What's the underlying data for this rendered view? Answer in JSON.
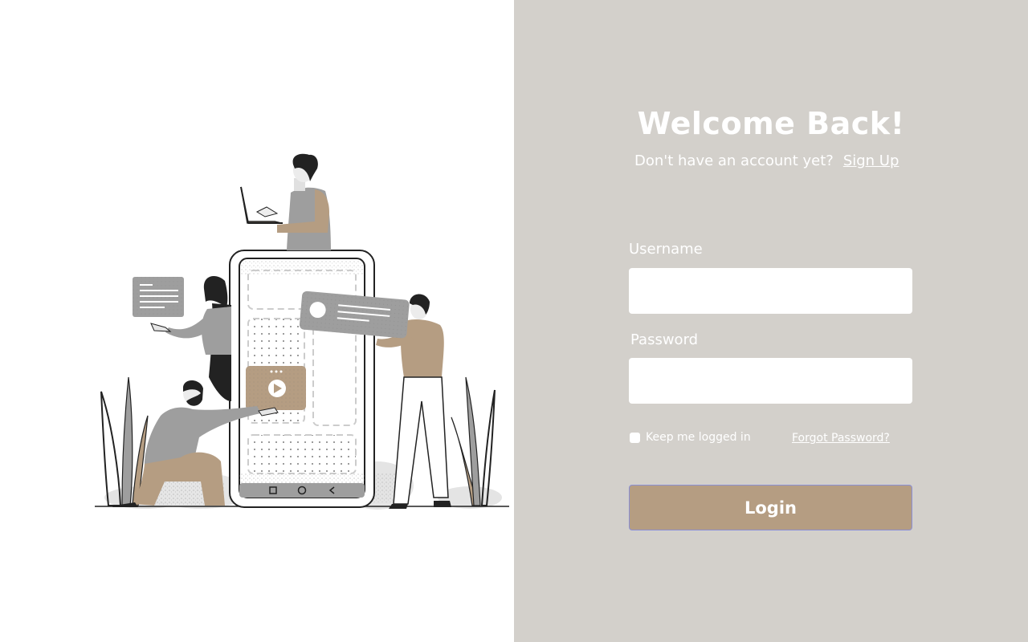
{
  "login": {
    "title": "Welcome Back!",
    "subtitle_text": "Don't have an account yet?",
    "signup_link": "Sign Up",
    "username_label": "Username",
    "username_value": "",
    "password_label": "Password",
    "password_value": "",
    "remember_label": "Keep me logged in",
    "remember_checked": false,
    "forgot_link": "Forgot Password?",
    "login_button": "Login"
  },
  "illustration": {
    "icon": "team-building-app-illustration"
  },
  "colors": {
    "right_panel_bg": "#d3d0cb",
    "accent_tan": "#b59d82",
    "text_white": "#ffffff",
    "figure_gray": "#9e9e9e"
  }
}
